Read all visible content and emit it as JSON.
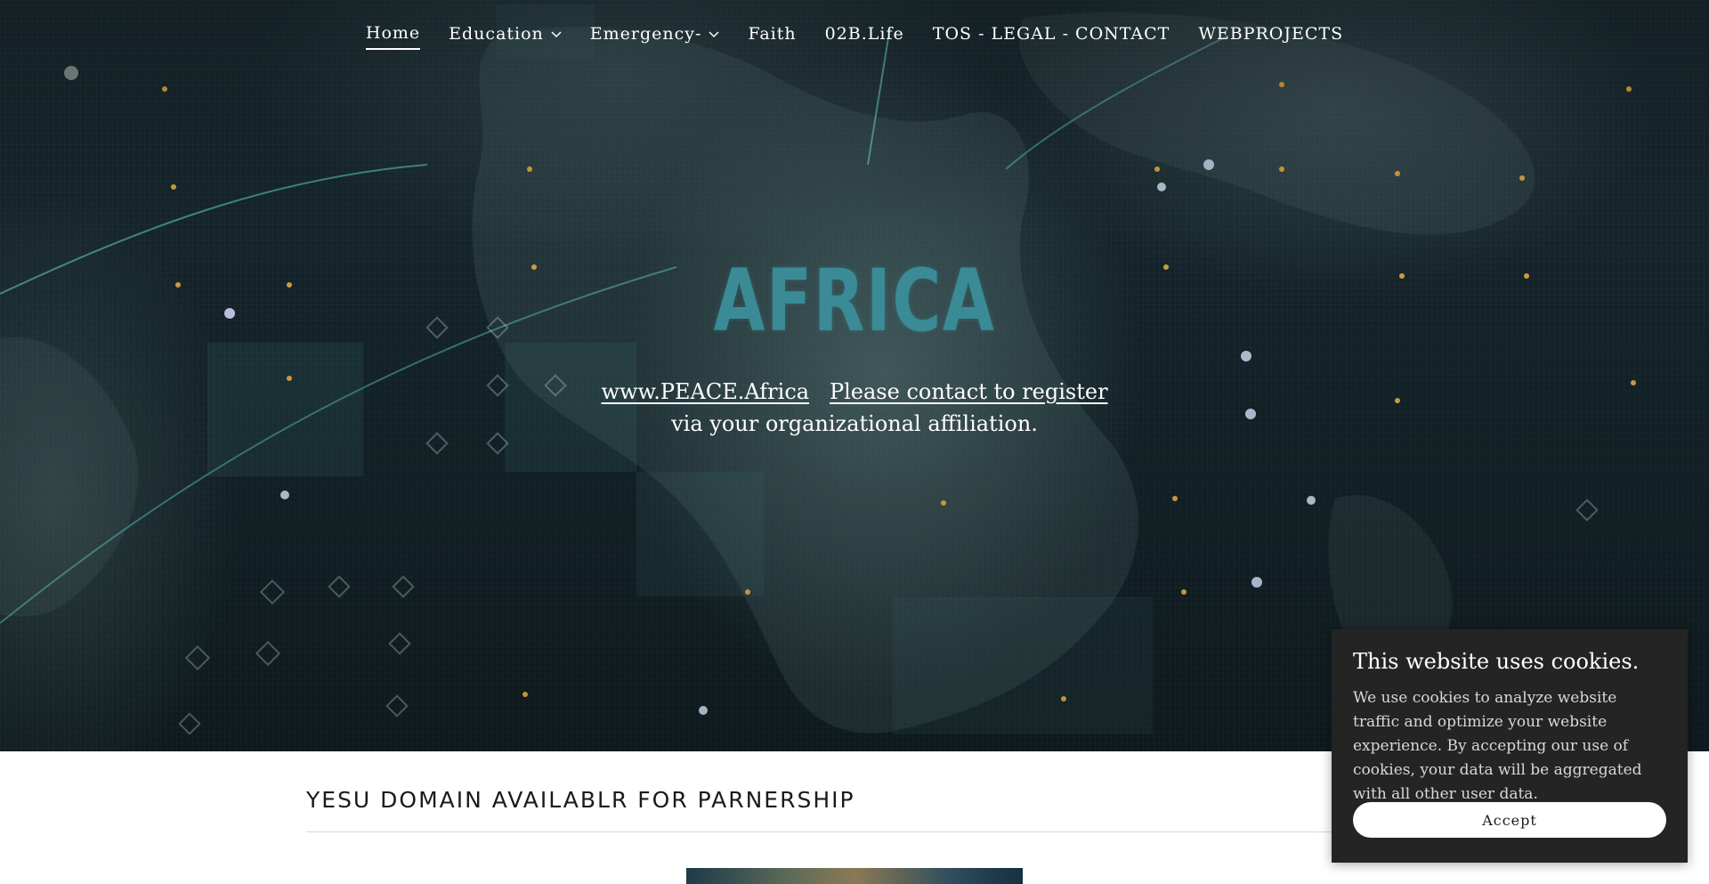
{
  "nav": {
    "items": [
      {
        "label": "Home",
        "active": true,
        "dropdown": false
      },
      {
        "label": "Education",
        "active": false,
        "dropdown": true
      },
      {
        "label": "Emergency-",
        "active": false,
        "dropdown": true
      },
      {
        "label": "Faith",
        "active": false,
        "dropdown": false
      },
      {
        "label": "02B.Life",
        "active": false,
        "dropdown": false
      },
      {
        "label": "TOS - LEGAL - CONTACT",
        "active": false,
        "dropdown": false
      },
      {
        "label": "WEBPROJECTS",
        "active": false,
        "dropdown": false
      }
    ]
  },
  "hero": {
    "image_text": "AFRICA",
    "link_site": "www.PEACE.Africa",
    "link_register": "Please contact to register",
    "text_after": " via your organizational affiliation."
  },
  "section": {
    "title": "YESU DOMAIN AVAILABLR FOR PARNERSHIP"
  },
  "cookie": {
    "title": "This website uses cookies.",
    "body": "We use cookies to analyze website traffic and optimize your website experience. By accepting our use of cookies, your data will be aggregated with all other user data.",
    "accept_label": "Accept"
  },
  "colors": {
    "hero_dark": "#14242a",
    "africa_text": "#3a8b96",
    "cookie_bg": "#242424",
    "nav_text": "#ffffff"
  }
}
